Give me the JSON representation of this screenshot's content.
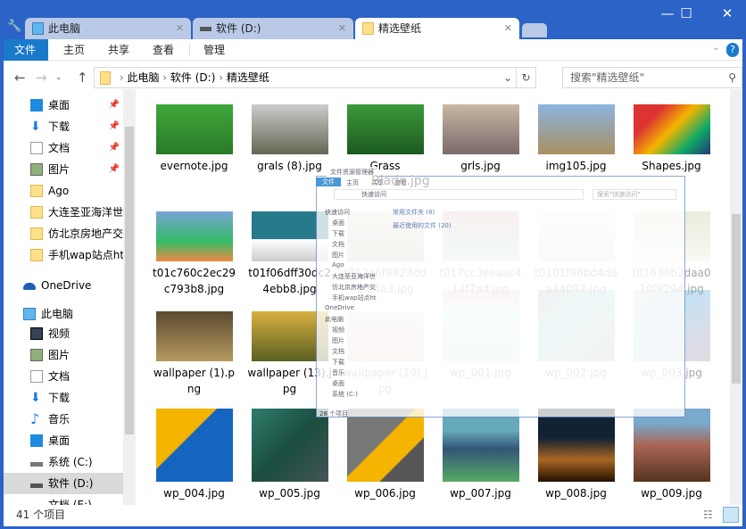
{
  "window": {
    "controls": {
      "minimize": "—",
      "maximize": "☐",
      "close": "✕"
    }
  },
  "tabs": [
    {
      "label": "此电脑",
      "icon": "computer-icon"
    },
    {
      "label": "软件 (D:)",
      "icon": "drive-icon"
    },
    {
      "label": "精选壁纸",
      "icon": "folder-icon",
      "active": true
    }
  ],
  "ribbon": {
    "tabs": [
      "文件",
      "主页",
      "共享",
      "查看",
      "管理"
    ]
  },
  "address": {
    "parts": [
      "此电脑",
      "软件 (D:)",
      "精选壁纸"
    ],
    "search_placeholder": "搜索\"精选壁纸\""
  },
  "sidebar": {
    "items": [
      {
        "label": "桌面",
        "icon": "desktop-icon",
        "pinned": true
      },
      {
        "label": "下载",
        "icon": "download-icon",
        "pinned": true
      },
      {
        "label": "文档",
        "icon": "document-icon",
        "pinned": true
      },
      {
        "label": "图片",
        "icon": "pictures-icon",
        "pinned": true
      },
      {
        "label": "Ago",
        "icon": "folder-icon"
      },
      {
        "label": "大连圣亚海洋世界",
        "icon": "folder-icon"
      },
      {
        "label": "仿北京房地产交易",
        "icon": "folder-icon"
      },
      {
        "label": "手机wap站点html",
        "icon": "folder-icon"
      },
      {
        "label": "OneDrive",
        "icon": "onedrive-icon"
      },
      {
        "label": "此电脑",
        "icon": "computer-icon"
      },
      {
        "label": "视频",
        "icon": "video-icon"
      },
      {
        "label": "图片",
        "icon": "pictures-icon"
      },
      {
        "label": "文档",
        "icon": "document-icon"
      },
      {
        "label": "下载",
        "icon": "download-icon"
      },
      {
        "label": "音乐",
        "icon": "music-icon"
      },
      {
        "label": "桌面",
        "icon": "desktop-icon"
      },
      {
        "label": "系统 (C:)",
        "icon": "system-drive-icon"
      },
      {
        "label": "软件 (D:)",
        "icon": "drive-icon",
        "selected": true
      },
      {
        "label": "文档 (E:)",
        "icon": "drive-icon"
      }
    ]
  },
  "files": [
    [
      "evernote.jpg",
      "grals (8).jpg",
      "Grass",
      "grls.jpg",
      "img105.jpg",
      "Shapes.jpg"
    ],
    [
      "t01c760c2ec29c793b8.jpg",
      "t01f06dff30dc24ebb8.jpg",
      "t012a6f9823dd0fe4a3.jpg",
      "t017cc3eaaac414f7a4.jpg",
      "t0101f86bd4d8a44097.jpg",
      "t01636b2daa010f9294.jpg"
    ],
    [
      "wallpaper (1).png",
      "wallpaper (13).jpg",
      "wallpaper (19).jpg",
      "wp_001.jpg",
      "wp_002.jpg",
      "wp_003.jpg"
    ],
    [
      "wp_004.jpg",
      "wp_005.jpg",
      "wp_006.jpg",
      "wp_007.jpg",
      "wp_008.jpg",
      "wp_009.jpg"
    ]
  ],
  "status": {
    "count": "41 个项目"
  },
  "drag_window": {
    "title": "文件资源管理器",
    "tabs": [
      "文件",
      "主页",
      "共享",
      "查看"
    ],
    "path": "快速访问",
    "search": "搜索\"快速访问\"",
    "groups": [
      "常用文件夹 (8)",
      "最近使用的文件 (20)"
    ],
    "nav": [
      "快速访问",
      "桌面",
      "下载",
      "文档",
      "图片",
      "Ago",
      "大连圣亚海洋世",
      "仿北京房地产交",
      "手机wap站点ht",
      "OneDrive",
      "此电脑",
      "视频",
      "图片",
      "文档",
      "下载",
      "音乐",
      "桌面",
      "系统 (C:)"
    ],
    "status": "28 个项目",
    "ghost_label": "Blade.jpg"
  },
  "colors": {
    "frame": "#2b63c6",
    "accent": "#1979ca",
    "selected": "#d9d9d9"
  }
}
